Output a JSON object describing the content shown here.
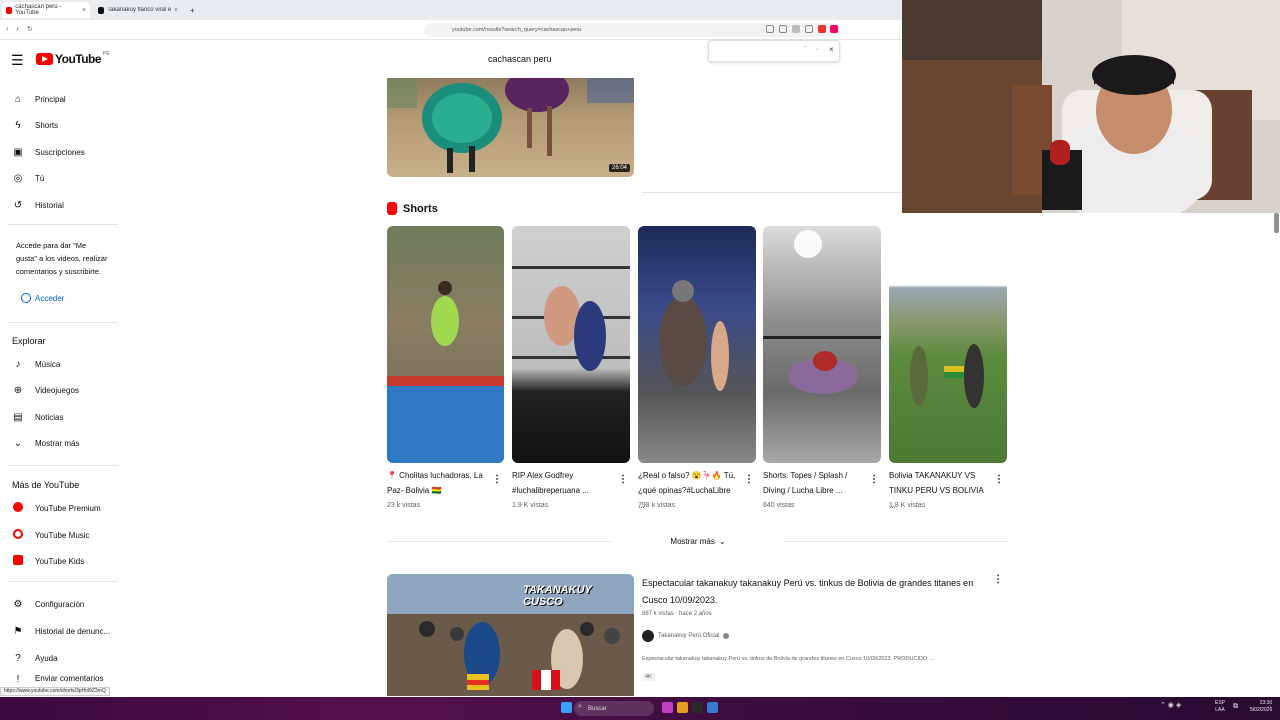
{
  "browser": {
    "tabs": [
      {
        "title": "cachascan peru - YouTube"
      },
      {
        "title": "Takanakuy flanco viral en TikTok | ..."
      }
    ],
    "url": "youtube.com/results?search_query=cachascan+peru",
    "status_url": "https://www.youtube.com/shorts/3pHnl9Z3mQ"
  },
  "header": {
    "logo_text": "YouTube",
    "country_code": "PE",
    "search_value": "cachascan peru"
  },
  "sidebar": {
    "main": [
      {
        "label": "Principal",
        "icon": "home-icon"
      },
      {
        "label": "Shorts",
        "icon": "shorts-icon"
      },
      {
        "label": "Suscripciones",
        "icon": "subscriptions-icon"
      },
      {
        "label": "Tú",
        "icon": "you-icon"
      },
      {
        "label": "Historial",
        "icon": "history-icon"
      }
    ],
    "signin_prompt": "Accede para dar \"Me gusta\" a los videos, realizar comentarios y suscribirte.",
    "signin_button": "Acceder",
    "explore_heading": "Explorar",
    "explore": [
      {
        "label": "Música",
        "icon": "music-icon"
      },
      {
        "label": "Videojuegos",
        "icon": "gaming-icon"
      },
      {
        "label": "Noticias",
        "icon": "news-icon"
      },
      {
        "label": "Mostrar más",
        "icon": "chevron-down-icon"
      }
    ],
    "more_heading": "Más de YouTube",
    "more": [
      {
        "label": "YouTube Premium"
      },
      {
        "label": "YouTube Music"
      },
      {
        "label": "YouTube Kids"
      }
    ],
    "settings": [
      {
        "label": "Configuración",
        "icon": "settings-icon"
      },
      {
        "label": "Historial de denunc...",
        "icon": "flag-icon"
      },
      {
        "label": "Ayuda",
        "icon": "help-icon"
      },
      {
        "label": "Enviar comentarios",
        "icon": "feedback-icon"
      }
    ]
  },
  "top_video": {
    "duration": "26:04"
  },
  "shorts_section": {
    "title": "Shorts",
    "items": [
      {
        "title": "📍 Cholitas luchadoras, La Paz- Bolivia 🇧🇴",
        "views": "23 k vistas"
      },
      {
        "title": "RIP Alex Godfrey #luchalibreperuana ...",
        "views": "1.9 K vistas"
      },
      {
        "title": "¿Real o falso? 😮🦩🔥 Tú, ¿qué opinas?#LuchaLibre ...",
        "views": "798 k vistas"
      },
      {
        "title": "Shorts: Topes / Splash / Diving / Lucha Libre ...",
        "views": "640 vistas"
      },
      {
        "title": "Bolivia TAKANAKUY VS TINKU PERU VS BOLIVIA ...",
        "views": "1.8 K vistas"
      }
    ],
    "show_more": "Mostrar más"
  },
  "video_result": {
    "title": "Espectacular takanakuy takanakuy Perú vs. tinkus de Bolivia de grandes titanes en Cusco 10/09/2023.",
    "meta": "887 k vistas · hace 2 años",
    "channel": "Takanakuy Perú Oficial",
    "description": "Espectacular takanakuy takanakuy Perú vs. tinkus de Bolivia de grandes titanes en Cusco 10/09/2023. PRODUCIDO: ...",
    "badge": "4K",
    "thumb_text": "TAKANAKUY CUSCO"
  },
  "taskbar": {
    "search_label": "Buscar",
    "lang": "ESP",
    "lang2": "LAA",
    "time": "23:30",
    "date": "5/02/2026"
  },
  "colors": {
    "brand_red": "#ff0000",
    "accent_blue": "#065fd4"
  }
}
